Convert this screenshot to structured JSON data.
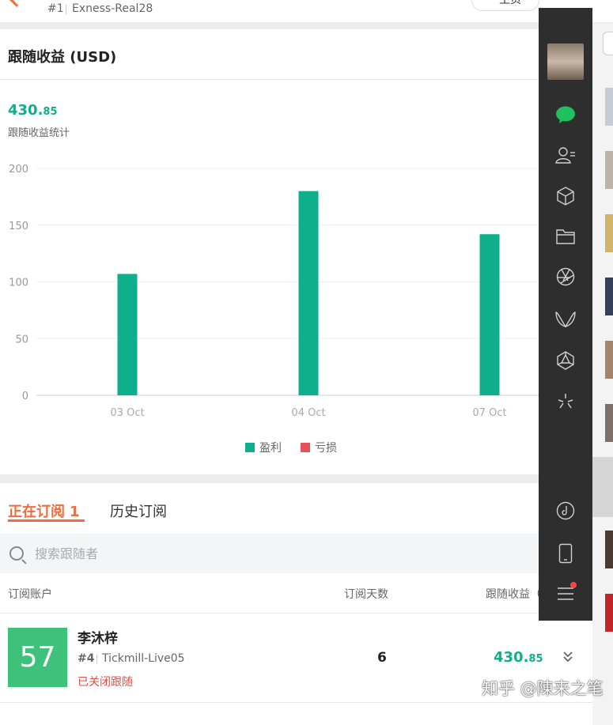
{
  "header": {
    "rank": "#1",
    "account": "Exness-Real28",
    "share_label": "主页"
  },
  "summary": {
    "section_title": "跟随收益 (USD)",
    "total_int": "430.",
    "total_dec": "85",
    "total_label": "跟随收益统计"
  },
  "chart_data": {
    "type": "bar",
    "categories": [
      "03 Oct",
      "04 Oct",
      "07 Oct"
    ],
    "series": [
      {
        "name": "盈利",
        "values": [
          107,
          180,
          142
        ],
        "color": "#0fae8c"
      },
      {
        "name": "亏损",
        "values": [
          0,
          0,
          0
        ],
        "color": "#e8505b"
      }
    ],
    "ylim": [
      0,
      200
    ],
    "yticks": [
      "0",
      "50",
      "100",
      "150",
      "200"
    ],
    "grid": true,
    "legend": "bottom-center"
  },
  "tabs": {
    "active_label": "正在订阅",
    "active_count": "1",
    "history_label": "历史订阅"
  },
  "search": {
    "placeholder": "搜索跟随者"
  },
  "table": {
    "col_account": "订阅账户",
    "col_days": "订阅天数",
    "col_profit": "跟随收益（",
    "rows": [
      {
        "avatar_text": "57",
        "avatar_color": "#3ec27b",
        "name": "李沐梓",
        "rank": "#4",
        "account": "Tickmill-Live05",
        "status": "已关闭跟随",
        "days": "6",
        "profit_int": "430.",
        "profit_dec": "85"
      }
    ]
  },
  "sidebar": {
    "icons": [
      "chat-icon",
      "contacts-icon",
      "cube-icon",
      "folder-icon",
      "aperture-icon",
      "butterfly-icon",
      "polyhedron-icon",
      "sparkle-icon",
      "music-icon",
      "phone-icon",
      "menu-icon"
    ]
  },
  "watermark": "知乎 @陳来之笔",
  "colors": {
    "accent": "#f26b3a",
    "profit": "#0fae8c",
    "loss": "#e8505b",
    "sidebar_bg": "#2e2e2e"
  }
}
